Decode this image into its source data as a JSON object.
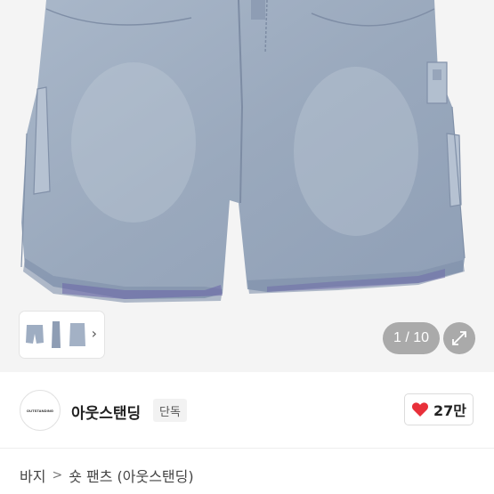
{
  "gallery": {
    "image_alt": "denim-carpenter-shorts",
    "counter": "1 / 10",
    "thumbnail_chevron": "›",
    "expand_icon": "expand-icon"
  },
  "seller": {
    "logo_text": "OUTSTANDING",
    "name": "아웃스탠딩",
    "badge": "단독",
    "like_count": "27만",
    "like_color": "#e8303a"
  },
  "breadcrumb": {
    "items": [
      "바지",
      "숏 팬츠 (아웃스탠딩)"
    ],
    "separator": ">"
  }
}
